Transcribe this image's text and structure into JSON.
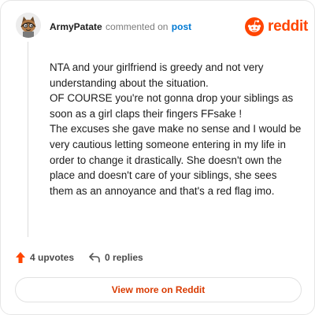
{
  "header": {
    "username": "ArmyPatate",
    "action_text": "commented on",
    "link_text": "post"
  },
  "brand": {
    "wordmark": "reddit",
    "color": "#ff4500"
  },
  "comment": {
    "paragraphs": [
      "NTA and your girlfriend is greedy and not very understanding about the situation.",
      "OF COURSE you're not gonna drop your siblings as soon as a girl claps their fingers FFsake !",
      "The excuses she gave make no sense and I would be very cautious letting someone entering in my life in order to change it drastically. She doesn't own the place and doesn't care of your siblings, she sees them as an annoyance and that's a red flag imo."
    ]
  },
  "actions": {
    "upvotes_label": "4 upvotes",
    "replies_label": "0 replies"
  },
  "footer": {
    "button_label": "View more on Reddit"
  },
  "icons": {
    "avatar": "avatar-icon",
    "upvote": "upvote-arrow-icon",
    "reply": "reply-arrow-icon",
    "logo": "reddit-snoo-icon"
  }
}
